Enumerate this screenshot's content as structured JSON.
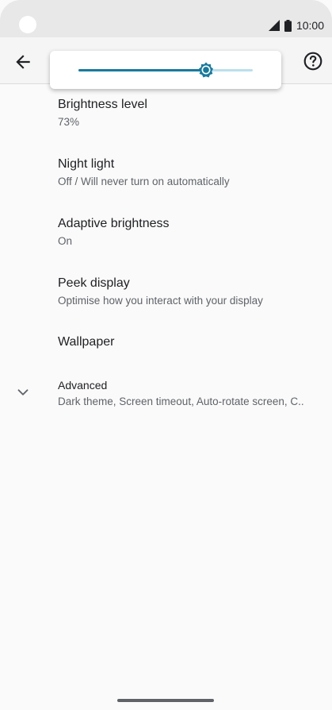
{
  "status_bar": {
    "time": "10:00"
  },
  "toolbar": {
    "back_icon": "arrow-back-icon",
    "help_icon": "help-icon"
  },
  "brightness_slider": {
    "level_percent": 73,
    "thumb_icon": "brightness-icon",
    "colors": {
      "fill": "#177a9f",
      "track": "#b9e0ec"
    }
  },
  "settings": [
    {
      "title": "Brightness level",
      "subtitle": "73%"
    },
    {
      "title": "Night light",
      "subtitle": "Off / Will never turn on automatically"
    },
    {
      "title": "Adaptive brightness",
      "subtitle": "On"
    },
    {
      "title": "Peek display",
      "subtitle": "Optimise how you interact with your display"
    },
    {
      "title": "Wallpaper"
    },
    {
      "title": "Advanced",
      "subtitle": "Dark theme, Screen timeout, Auto-rotate screen, C.."
    }
  ]
}
